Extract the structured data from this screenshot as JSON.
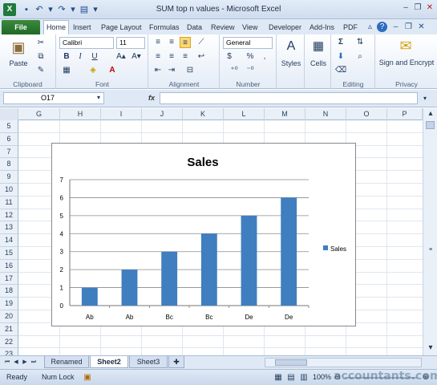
{
  "window": {
    "title": "SUM top n values - Microsoft Excel"
  },
  "ribbon_tabs": [
    "Home",
    "Insert",
    "Page Layout",
    "Formulas",
    "Data",
    "Review",
    "View",
    "Developer",
    "Add-Ins",
    "PDF"
  ],
  "file_tab": "File",
  "clipboard": {
    "paste": "Paste",
    "label": "Clipboard"
  },
  "font": {
    "name": "Calibri",
    "size": "11",
    "bold": "B",
    "italic": "I",
    "underline": "U",
    "label": "Font"
  },
  "alignment": {
    "label": "Alignment"
  },
  "number": {
    "format": "General",
    "currency": "$",
    "percent": "%",
    "comma": ",",
    "label": "Number"
  },
  "styles": {
    "label": "Styles"
  },
  "cells": {
    "label": "Cells"
  },
  "editing": {
    "label": "Editing"
  },
  "privacy": {
    "sign_encrypt": "Sign and Encrypt",
    "label": "Privacy"
  },
  "formula_bar": {
    "name_box": "O17",
    "fx": "fx",
    "formula": ""
  },
  "columns": [
    "G",
    "H",
    "I",
    "J",
    "K",
    "L",
    "M",
    "N",
    "O",
    "P"
  ],
  "rows": [
    "5",
    "6",
    "7",
    "8",
    "9",
    "10",
    "11",
    "12",
    "13",
    "14",
    "15",
    "16",
    "17",
    "18",
    "19",
    "20",
    "21",
    "22",
    "23"
  ],
  "sheets": [
    "Renamed",
    "Sheet2",
    "Sheet3"
  ],
  "active_sheet": "Sheet2",
  "status": {
    "mode": "Ready",
    "num_lock": "Num Lock",
    "zoom": "100%",
    "watermark": "accountants.com"
  },
  "chart_data": {
    "type": "bar",
    "title": "Sales",
    "categories": [
      "Ab",
      "Ab",
      "Bc",
      "Bc",
      "De",
      "De"
    ],
    "series": [
      {
        "name": "Sales",
        "values": [
          1,
          2,
          3,
          4,
          5,
          6
        ],
        "color": "#3f7fbf"
      }
    ],
    "ylim": [
      0,
      7
    ],
    "yticks": [
      0,
      1,
      2,
      3,
      4,
      5,
      6,
      7
    ],
    "grid": true,
    "legend": "right"
  }
}
